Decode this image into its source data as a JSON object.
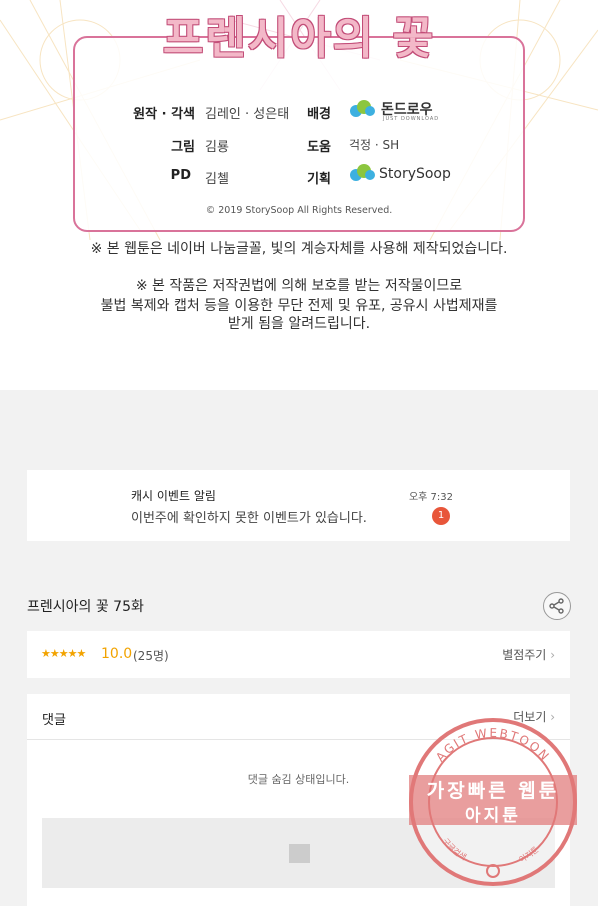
{
  "credits": {
    "series_logo": "프렌시아의 꽃",
    "rows": [
      {
        "key": "원작 · 각색",
        "value": "김레인 · 성은태"
      },
      {
        "key": "배경",
        "logo": "돈드로우",
        "logo_sub": "JUST DOWNLOAD"
      },
      {
        "key": "그림",
        "value": "김룡"
      },
      {
        "key": "도움",
        "value": "걱정 · SH"
      },
      {
        "key": "PD",
        "value": "김첼"
      },
      {
        "key": "기획",
        "logo": "StorySoop"
      }
    ],
    "copyright": "© 2019 StorySoop All Rights Reserved.",
    "notice_font": "※ 본 웹툰은 네이버 나눔글꼴, 빛의 계승자체를 사용해 제작되었습니다.",
    "notice_copyright": [
      "※ 본 작품은 저작권법에 의해 보호를 받는 저작물이므로",
      "불법 복제와 캡처 등을 이용한 무단 전제 및 유포, 공유시 사법제재를",
      "받게 됨을 알려드립니다."
    ]
  },
  "notification": {
    "title": "캐시 이벤트 알림",
    "time": "오후 7:32",
    "text": "이번주에 확인하지 못한 이벤트가 있습니다.",
    "badge": "1"
  },
  "episode": {
    "title": "프렌시아의 꽃 75화",
    "share_icon": "share-icon"
  },
  "rating": {
    "stars": "★★★★★",
    "score": "10.0",
    "count": "(25명)",
    "rate_link": "별점주기"
  },
  "comments": {
    "label": "댓글",
    "more_link": "더보기",
    "hidden_message": "댓글 숨김 상태입니다."
  },
  "watermark": {
    "ring_text": "AGIT WEBTOON",
    "line1": "가장빠른 웹툰",
    "line2": "아지툰",
    "bottom_left": "구글검색",
    "bottom_right": "아지툰"
  },
  "colors": {
    "accent_pink": "#d9739a",
    "star": "#f2a300",
    "badge": "#e8563a",
    "stamp": "#e07878"
  }
}
